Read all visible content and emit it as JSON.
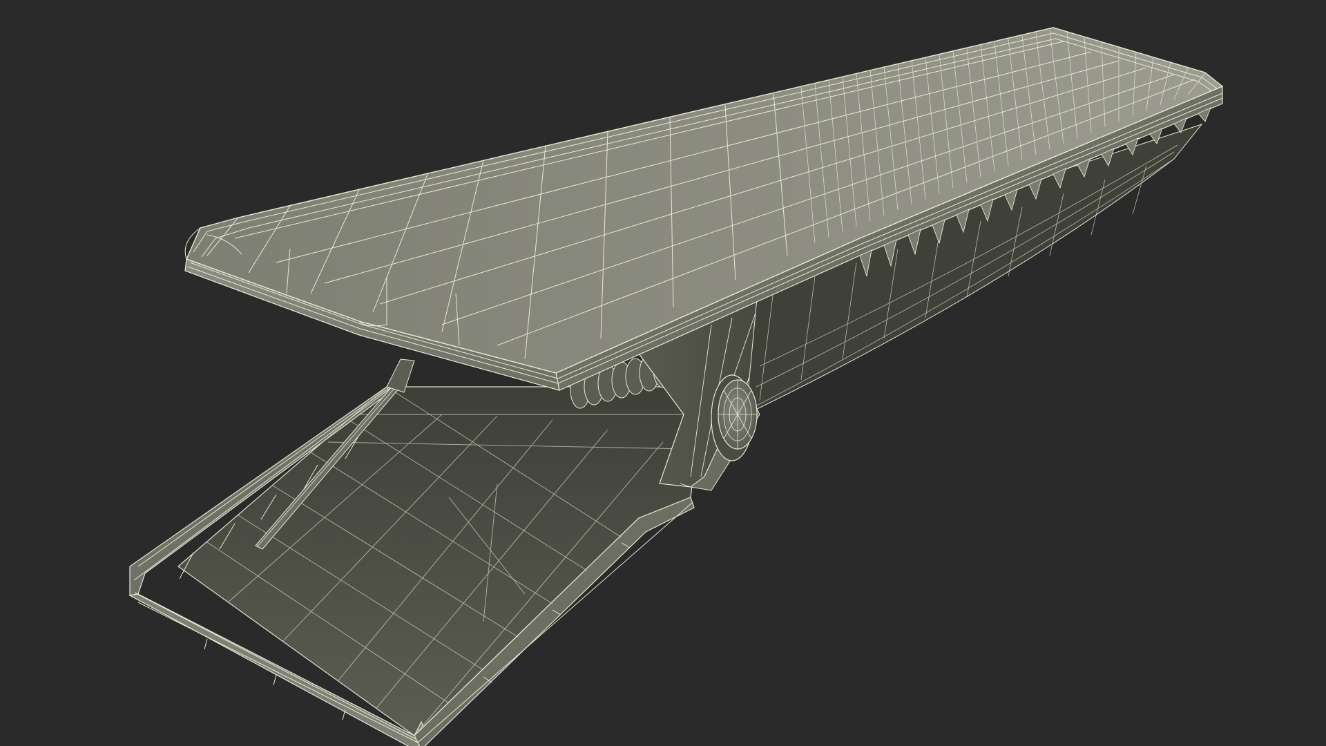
{
  "scene": {
    "subject": "clip-wireframe-render",
    "colors": {
      "background": "#2a2a2a",
      "surface_light": "#8a8b7f",
      "surface_mid": "#76786b",
      "surface_dark": "#4e5047",
      "surface_shadow": "#35362f",
      "wire": "#e9e9d6"
    },
    "parts": [
      "upper-lever",
      "upper-lever-teeth",
      "lower-jaw",
      "lower-jaw-rail",
      "pivot-spring",
      "pivot-disc",
      "side-bracket"
    ]
  }
}
